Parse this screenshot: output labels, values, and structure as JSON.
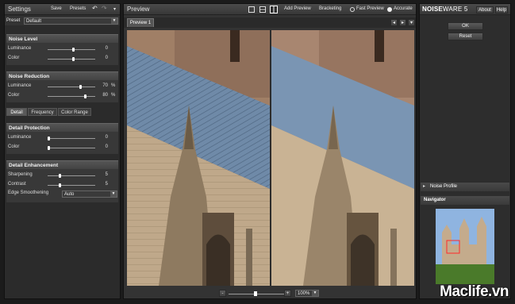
{
  "left": {
    "title": "Settings",
    "toolbar": {
      "save": "Save",
      "presets": "Presets",
      "menu": "▾"
    },
    "preset": {
      "label": "Preset",
      "value": "Default"
    },
    "noise_level": {
      "title": "Noise Level",
      "rows": [
        {
          "label": "Luminance",
          "value": "0",
          "unit": "",
          "pos": 0.55
        },
        {
          "label": "Color",
          "value": "0",
          "unit": "",
          "pos": 0.55
        }
      ]
    },
    "noise_reduction": {
      "title": "Noise Reduction",
      "rows": [
        {
          "label": "Luminance",
          "value": "70",
          "unit": "%",
          "pos": 0.7
        },
        {
          "label": "Color",
          "value": "80",
          "unit": "%",
          "pos": 0.8
        }
      ]
    },
    "tabs": [
      "Detail",
      "Frequency",
      "Color Range"
    ],
    "detail_protection": {
      "title": "Detail Protection",
      "rows": [
        {
          "label": "Luminance",
          "value": "0",
          "unit": "",
          "pos": 0.0
        },
        {
          "label": "Color",
          "value": "0",
          "unit": "",
          "pos": 0.0
        }
      ]
    },
    "detail_enhancement": {
      "title": "Detail Enhancement",
      "rows": [
        {
          "label": "Sharpening",
          "value": "5",
          "unit": "",
          "pos": 0.25
        },
        {
          "label": "Contrast",
          "value": "5",
          "unit": "",
          "pos": 0.25
        }
      ],
      "edge": {
        "label": "Edge Smoothening",
        "value": "Auto"
      }
    }
  },
  "center": {
    "title": "Preview",
    "add_preview": "Add Preview",
    "bracketing": "Bracketing",
    "fast_preview": "Fast Preview",
    "accurate": "Accurate",
    "tab": "Preview 1",
    "zoom": "100%",
    "zoom_minus": "-",
    "zoom_plus": "+"
  },
  "right": {
    "logo_bold": "NOISE",
    "logo_rest": "WARE 5",
    "about": "About",
    "help": "Help",
    "ok": "OK",
    "reset": "Reset",
    "noise_profile": "Noise Profile",
    "navigator": "Navigator"
  },
  "watermark": "Maclife.vn",
  "colors": {
    "accent": "#5a5a5a",
    "panel": "#2b2b2b",
    "roof": "#6e89a8",
    "stone": "#bfa88a"
  }
}
